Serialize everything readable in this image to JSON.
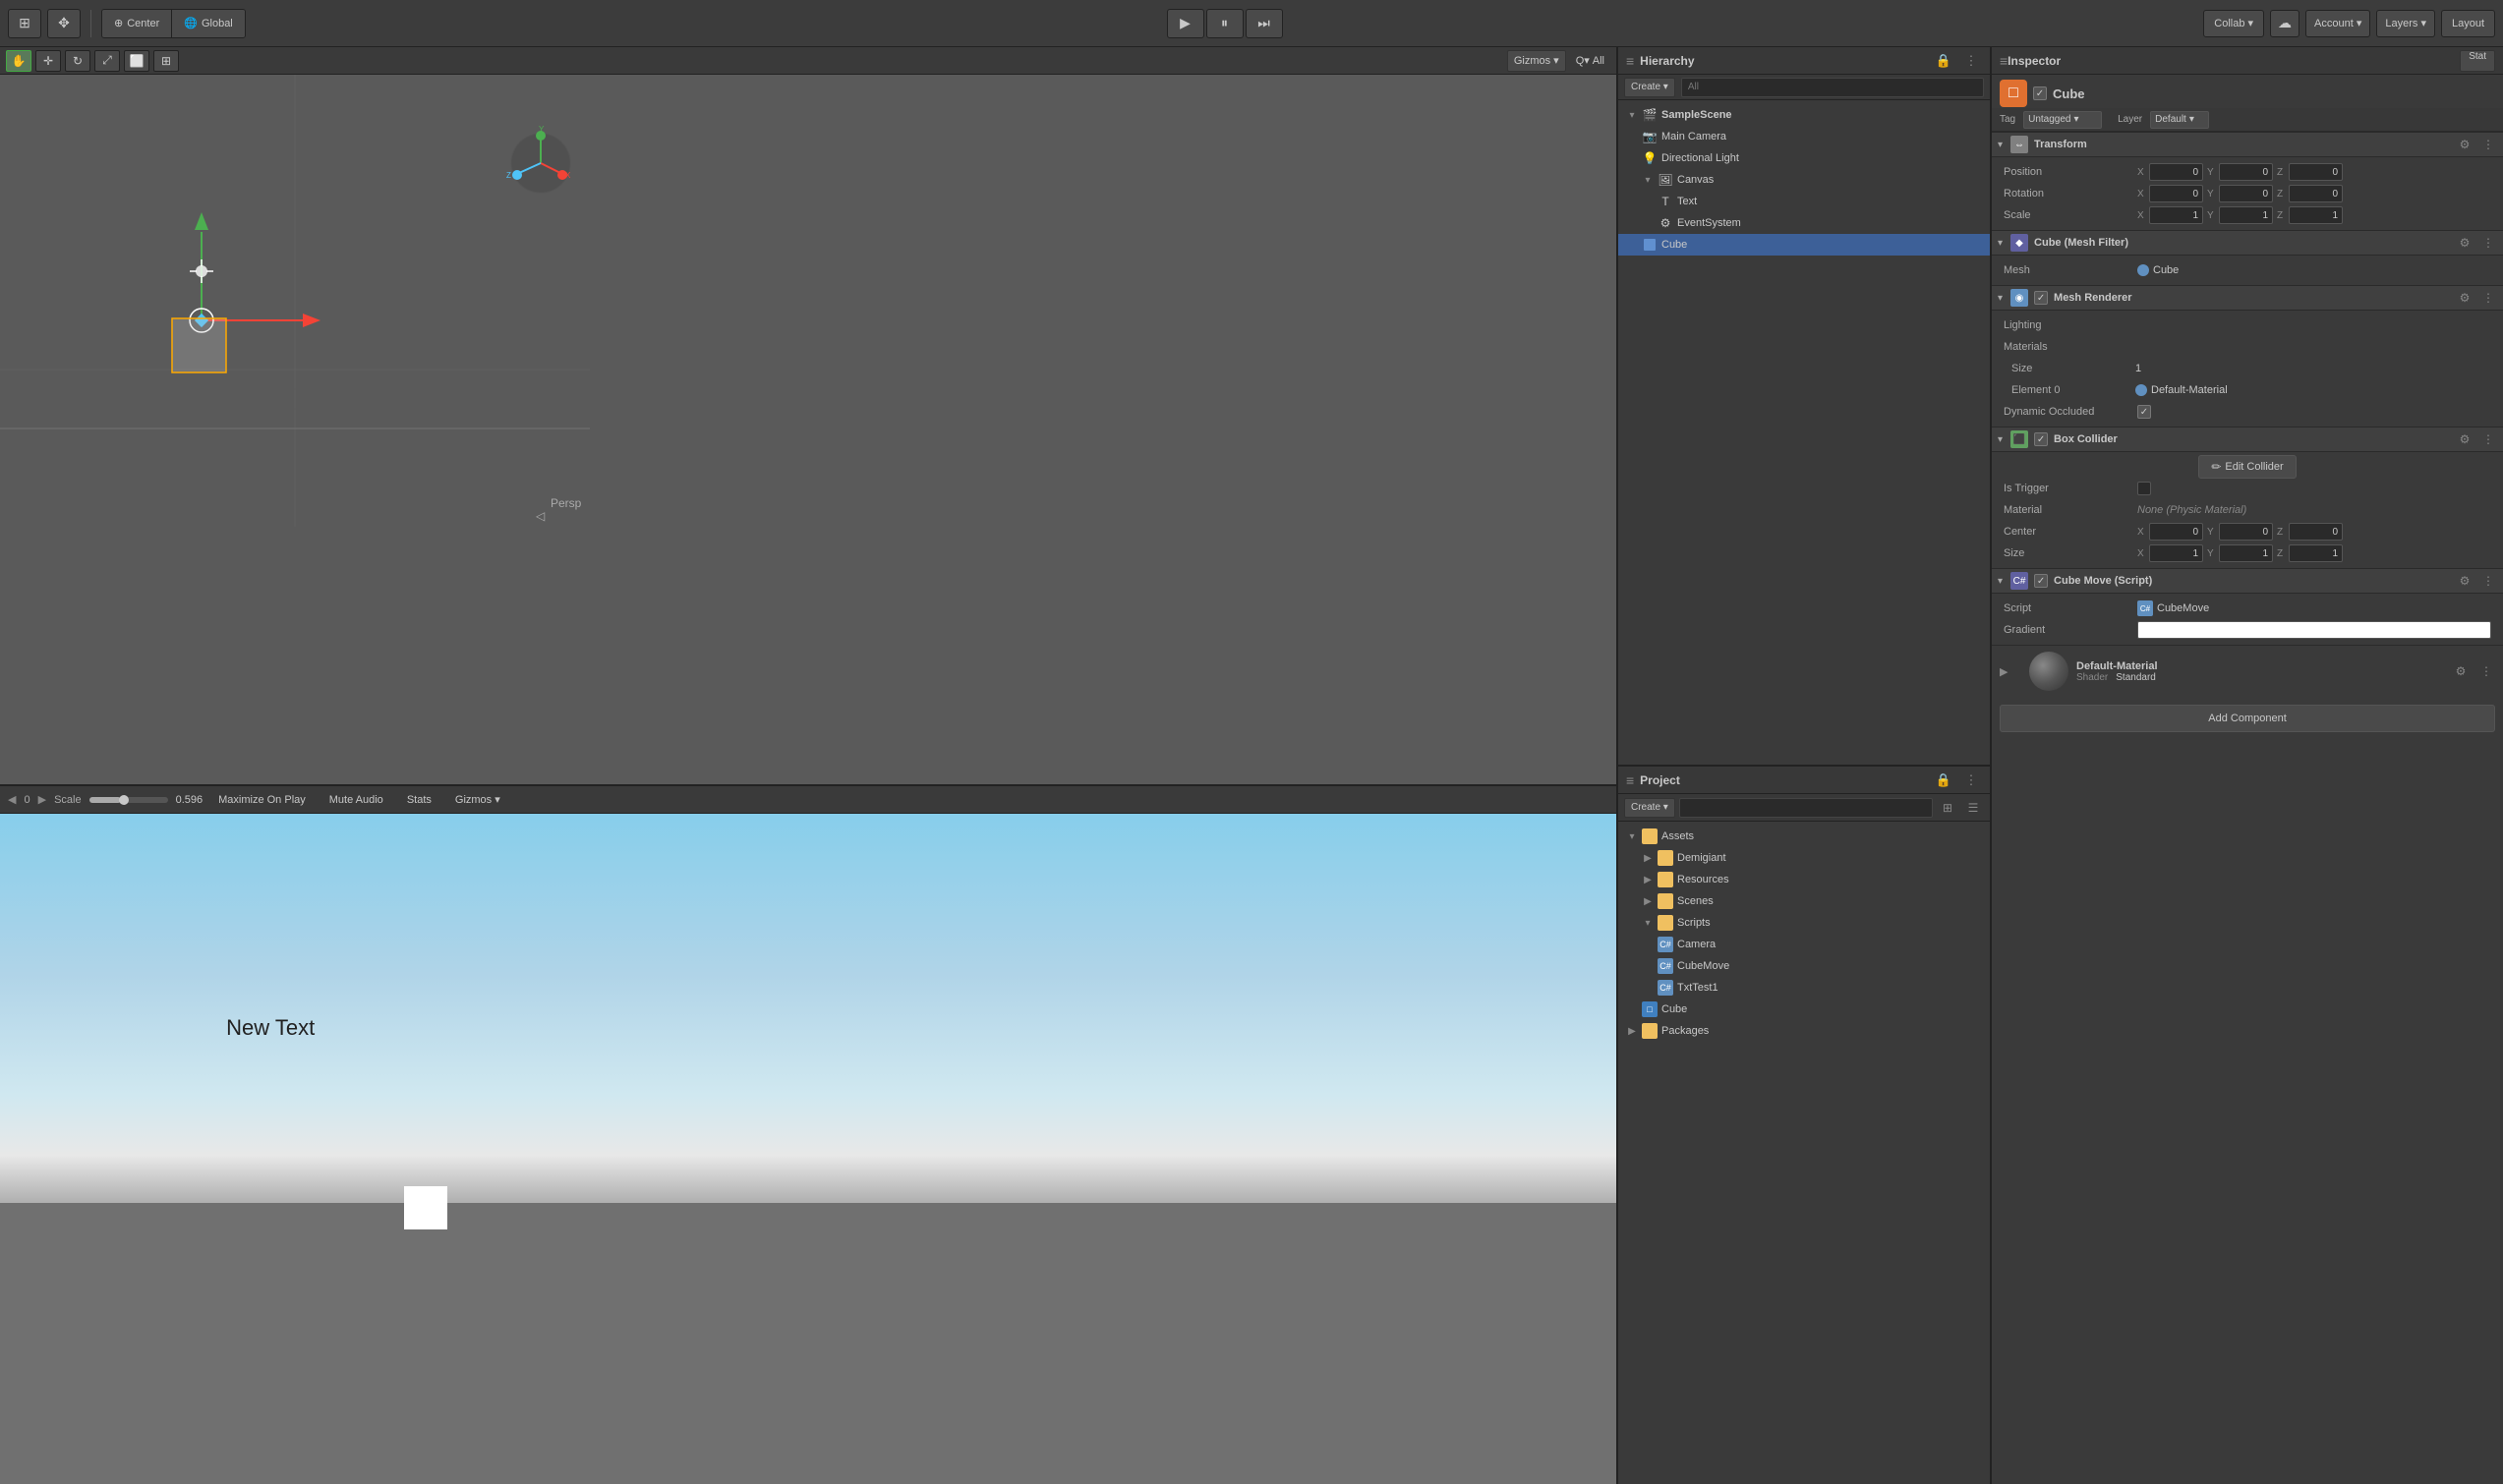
{
  "topbar": {
    "collab_label": "Collab ▾",
    "account_label": "Account ▾",
    "layers_label": "Layers ▾",
    "layout_label": "Layout"
  },
  "scene_toolbar": {
    "gizmos_label": "Gizmos",
    "all_label": "All"
  },
  "hierarchy": {
    "title": "Hierarchy",
    "create_label": "Create ▾",
    "search_placeholder": "All",
    "scene_name": "SampleScene",
    "items": [
      {
        "name": "Main Camera",
        "depth": 1,
        "type": "camera"
      },
      {
        "name": "Directional Light",
        "depth": 1,
        "type": "light"
      },
      {
        "name": "Canvas",
        "depth": 1,
        "type": "canvas"
      },
      {
        "name": "Text",
        "depth": 2,
        "type": "text"
      },
      {
        "name": "EventSystem",
        "depth": 2,
        "type": "eventsystem"
      },
      {
        "name": "Cube",
        "depth": 1,
        "type": "cube",
        "selected": true
      }
    ]
  },
  "project": {
    "title": "Project",
    "create_label": "Create ▾",
    "search_placeholder": "",
    "folders": [
      {
        "name": "Assets",
        "depth": 0,
        "type": "folder",
        "open": true
      },
      {
        "name": "Demigiant",
        "depth": 1,
        "type": "folder"
      },
      {
        "name": "Resources",
        "depth": 1,
        "type": "folder"
      },
      {
        "name": "Scenes",
        "depth": 1,
        "type": "folder"
      },
      {
        "name": "Scripts",
        "depth": 1,
        "type": "folder",
        "open": true
      },
      {
        "name": "Camera",
        "depth": 2,
        "type": "script"
      },
      {
        "name": "CubeMove",
        "depth": 2,
        "type": "script"
      },
      {
        "name": "TxtTest1",
        "depth": 2,
        "type": "script"
      },
      {
        "name": "Cube",
        "depth": 1,
        "type": "mesh"
      },
      {
        "name": "Packages",
        "depth": 0,
        "type": "folder"
      }
    ]
  },
  "inspector": {
    "title": "Inspector",
    "stat_label": "Stat",
    "object_name": "Cube",
    "tag_label": "Tag",
    "tag_value": "Untagged",
    "layer_label": "Layer",
    "layer_value": "Default",
    "transform": {
      "title": "Transform",
      "position_label": "Position",
      "rotation_label": "Rotation",
      "scale_label": "Scale",
      "pos_x": "0",
      "pos_y": "0",
      "pos_z": "0",
      "rot_x": "0",
      "rot_y": "0",
      "rot_z": "0",
      "scl_x": "1",
      "scl_y": "1",
      "scl_z": "1"
    },
    "mesh_filter": {
      "title": "Cube (Mesh Filter)",
      "mesh_label": "Mesh",
      "mesh_value": "Cube"
    },
    "mesh_renderer": {
      "title": "Mesh Renderer",
      "lighting_label": "Lighting",
      "materials_label": "Materials",
      "size_label": "Size",
      "size_value": "1",
      "element0_label": "Element 0",
      "element0_value": "Default-Material",
      "dynamic_occluded_label": "Dynamic Occluded"
    },
    "box_collider": {
      "title": "Box Collider",
      "edit_collider_label": "Edit Collider",
      "is_trigger_label": "Is Trigger",
      "material_label": "Material",
      "material_value": "None (Physic Material)",
      "center_label": "Center",
      "center_x": "0",
      "center_y": "0",
      "center_z": "0",
      "size_label": "Size",
      "size_x": "1",
      "size_y": "1",
      "size_z": "1"
    },
    "cube_move": {
      "title": "Cube Move (Script)",
      "script_label": "Script",
      "script_value": "CubeMove",
      "gradient_label": "Gradient"
    },
    "material": {
      "name": "Default-Material",
      "shader_label": "Shader",
      "shader_value": "Standard"
    },
    "add_component_label": "Add Component"
  },
  "game_view": {
    "new_text": "New Text",
    "scale_label": "Scale",
    "scale_value": "0.596",
    "maximize_label": "Maximize On Play",
    "mute_label": "Mute Audio",
    "stats_label": "Stats",
    "gizmos_label": "Gizmos ▾"
  }
}
